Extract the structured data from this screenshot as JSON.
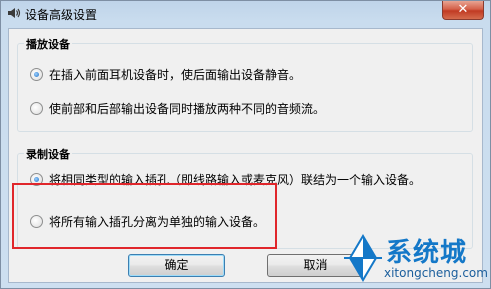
{
  "window": {
    "title": "设备高级设置",
    "close_symbol": "✕",
    "title_icon": "speaker-icon"
  },
  "playback_group": {
    "legend": "播放设备",
    "options": [
      {
        "label": "在插入前面耳机设备时，使后面输出设备静音。",
        "checked": true
      },
      {
        "label": "使前部和后部输出设备同时播放两种不同的音频流。",
        "checked": false
      }
    ]
  },
  "recording_group": {
    "legend": "录制设备",
    "options": [
      {
        "label": "将相同类型的输入插孔（即线路输入或麦克风）联结为一个输入设备。",
        "checked": true
      },
      {
        "label": "将所有输入插孔分离为单独的输入设备。",
        "checked": false
      }
    ]
  },
  "buttons": {
    "ok": "确定",
    "cancel": "取消"
  },
  "watermark": {
    "name": "系统城",
    "url": "xitongcheng.com",
    "color": "#1478c8"
  }
}
